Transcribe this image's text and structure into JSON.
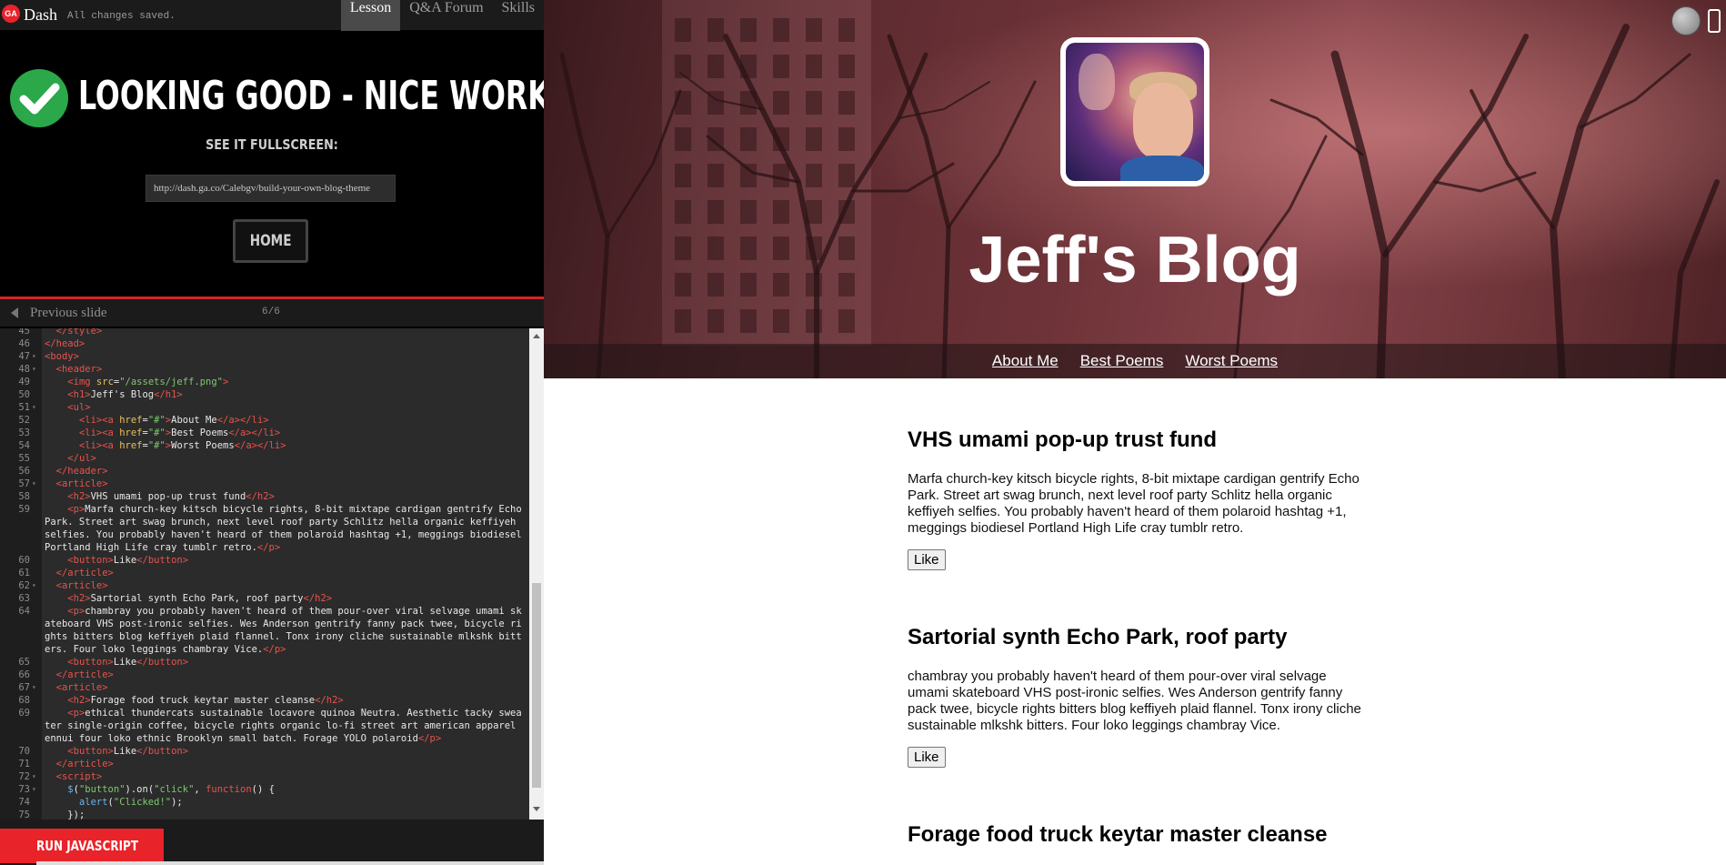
{
  "app": {
    "logo_text": "GA",
    "brand": "Dash",
    "save_status": "All changes saved."
  },
  "tabs": [
    {
      "label": "Lesson",
      "active": true
    },
    {
      "label": "Q&A Forum",
      "active": false
    },
    {
      "label": "Skills",
      "active": false
    }
  ],
  "success": {
    "title": "LOOKING GOOD - NICE WORK!",
    "fullscreen_label": "SEE IT FULLSCREEN:",
    "url": "http://dash.ga.co/Calebgv/build-your-own-blog-theme",
    "home_label": "HOME"
  },
  "slide_nav": {
    "prev_label": "Previous slide",
    "counter": "6/6"
  },
  "editor": {
    "lines": [
      {
        "n": "45",
        "fold": false,
        "html": "  <span class='t'>&lt;/style&gt;</span>"
      },
      {
        "n": "46",
        "fold": false,
        "html": "<span class='t'>&lt;/head&gt;</span>"
      },
      {
        "n": "47",
        "fold": true,
        "html": "<span class='t'>&lt;body&gt;</span>"
      },
      {
        "n": "48",
        "fold": true,
        "html": "  <span class='t'>&lt;header&gt;</span>"
      },
      {
        "n": "49",
        "fold": false,
        "html": "    <span class='t'>&lt;img</span> <span class='a'>src</span>=<span class='s'>\"/assets/jeff.png\"</span><span class='t'>&gt;</span>"
      },
      {
        "n": "50",
        "fold": false,
        "html": "    <span class='t'>&lt;h1&gt;</span>Jeff's Blog<span class='t'>&lt;/h1&gt;</span>"
      },
      {
        "n": "51",
        "fold": true,
        "html": "    <span class='t'>&lt;ul&gt;</span>"
      },
      {
        "n": "52",
        "fold": false,
        "html": "      <span class='t'>&lt;li&gt;&lt;a</span> <span class='a'>href</span>=<span class='s'>\"#\"</span><span class='t'>&gt;</span>About Me<span class='t'>&lt;/a&gt;&lt;/li&gt;</span>"
      },
      {
        "n": "53",
        "fold": false,
        "html": "      <span class='t'>&lt;li&gt;&lt;a</span> <span class='a'>href</span>=<span class='s'>\"#\"</span><span class='t'>&gt;</span>Best Poems<span class='t'>&lt;/a&gt;&lt;/li&gt;</span>"
      },
      {
        "n": "54",
        "fold": false,
        "html": "      <span class='t'>&lt;li&gt;&lt;a</span> <span class='a'>href</span>=<span class='s'>\"#\"</span><span class='t'>&gt;</span>Worst Poems<span class='t'>&lt;/a&gt;&lt;/li&gt;</span>"
      },
      {
        "n": "55",
        "fold": false,
        "html": "    <span class='t'>&lt;/ul&gt;</span>"
      },
      {
        "n": "56",
        "fold": false,
        "html": "  <span class='t'>&lt;/header&gt;</span>"
      },
      {
        "n": "57",
        "fold": true,
        "html": "  <span class='t'>&lt;article&gt;</span>"
      },
      {
        "n": "58",
        "fold": false,
        "html": "    <span class='t'>&lt;h2&gt;</span>VHS umami pop-up trust fund<span class='t'>&lt;/h2&gt;</span>"
      },
      {
        "n": "59",
        "fold": false,
        "html": "    <span class='t'>&lt;p&gt;</span>Marfa church-key kitsch bicycle rights, 8-bit mixtape cardigan gentrify Echo Park. Street art swag brunch, next level roof party Schlitz hella organic keffiyeh selfies. You probably haven't heard of them polaroid hashtag +1, meggings biodiesel Portland High Life cray tumblr retro.<span class='t'>&lt;/p&gt;</span>"
      },
      {
        "n": "60",
        "fold": false,
        "html": "    <span class='t'>&lt;button&gt;</span>Like<span class='t'>&lt;/button&gt;</span>"
      },
      {
        "n": "61",
        "fold": false,
        "html": "  <span class='t'>&lt;/article&gt;</span>"
      },
      {
        "n": "62",
        "fold": true,
        "html": "  <span class='t'>&lt;article&gt;</span>"
      },
      {
        "n": "63",
        "fold": false,
        "html": "    <span class='t'>&lt;h2&gt;</span>Sartorial synth Echo Park, roof party<span class='t'>&lt;/h2&gt;</span>"
      },
      {
        "n": "64",
        "fold": false,
        "html": "    <span class='t'>&lt;p&gt;</span>chambray you probably haven't heard of them pour-over viral selvage umami skateboard VHS post-ironic selfies. Wes Anderson gentrify fanny pack twee, bicycle rights bitters blog keffiyeh plaid flannel. Tonx irony cliche sustainable mlkshk bitters. Four loko leggings chambray Vice.<span class='t'>&lt;/p&gt;</span>"
      },
      {
        "n": "65",
        "fold": false,
        "html": "    <span class='t'>&lt;button&gt;</span>Like<span class='t'>&lt;/button&gt;</span>"
      },
      {
        "n": "66",
        "fold": false,
        "html": "  <span class='t'>&lt;/article&gt;</span>"
      },
      {
        "n": "67",
        "fold": true,
        "html": "  <span class='t'>&lt;article&gt;</span>"
      },
      {
        "n": "68",
        "fold": false,
        "html": "    <span class='t'>&lt;h2&gt;</span>Forage food truck keytar master cleanse<span class='t'>&lt;/h2&gt;</span>"
      },
      {
        "n": "69",
        "fold": false,
        "html": "    <span class='t'>&lt;p&gt;</span>ethical thundercats sustainable locavore quinoa Neutra. Aesthetic tacky sweater single-origin coffee, bicycle rights organic lo-fi street art american apparel ennui four loko ethnic Brooklyn small batch. Forage YOLO polaroid<span class='t'>&lt;/p&gt;</span>"
      },
      {
        "n": "70",
        "fold": false,
        "html": "    <span class='t'>&lt;button&gt;</span>Like<span class='t'>&lt;/button&gt;</span>"
      },
      {
        "n": "71",
        "fold": false,
        "html": "  <span class='t'>&lt;/article&gt;</span>"
      },
      {
        "n": "72",
        "fold": true,
        "html": "  <span class='t'>&lt;script&gt;</span>"
      },
      {
        "n": "73",
        "fold": true,
        "html": "    <span class='fn'>$</span>(<span class='s'>\"button\"</span>).on(<span class='s'>\"click\"</span>, <span class='k'>function</span>() {"
      },
      {
        "n": "74",
        "fold": false,
        "html": "      <span class='fn'>alert</span>(<span class='s'>\"Clicked!\"</span>);"
      },
      {
        "n": "75",
        "fold": false,
        "html": "    });"
      }
    ]
  },
  "run_button": "RUN JAVASCRIPT",
  "blog": {
    "title": "Jeff's Blog",
    "nav": [
      "About Me",
      "Best Poems",
      "Worst Poems"
    ],
    "posts": [
      {
        "title": "VHS umami pop-up trust fund",
        "body": "Marfa church-key kitsch bicycle rights, 8-bit mixtape cardigan gentrify Echo Park. Street art swag brunch, next level roof party Schlitz hella organic keffiyeh selfies. You probably haven't heard of them polaroid hashtag +1, meggings biodiesel Portland High Life cray tumblr retro.",
        "button": "Like"
      },
      {
        "title": "Sartorial synth Echo Park, roof party",
        "body": "chambray you probably haven't heard of them pour-over viral selvage umami skateboard VHS post-ironic selfies. Wes Anderson gentrify fanny pack twee, bicycle rights bitters blog keffiyeh plaid flannel. Tonx irony cliche sustainable mlkshk bitters. Four loko leggings chambray Vice.",
        "button": "Like"
      },
      {
        "title": "Forage food truck keytar master cleanse",
        "body": "",
        "button": ""
      }
    ]
  },
  "colors": {
    "accent_red": "#e8232a",
    "success_green": "#2aa84a"
  }
}
